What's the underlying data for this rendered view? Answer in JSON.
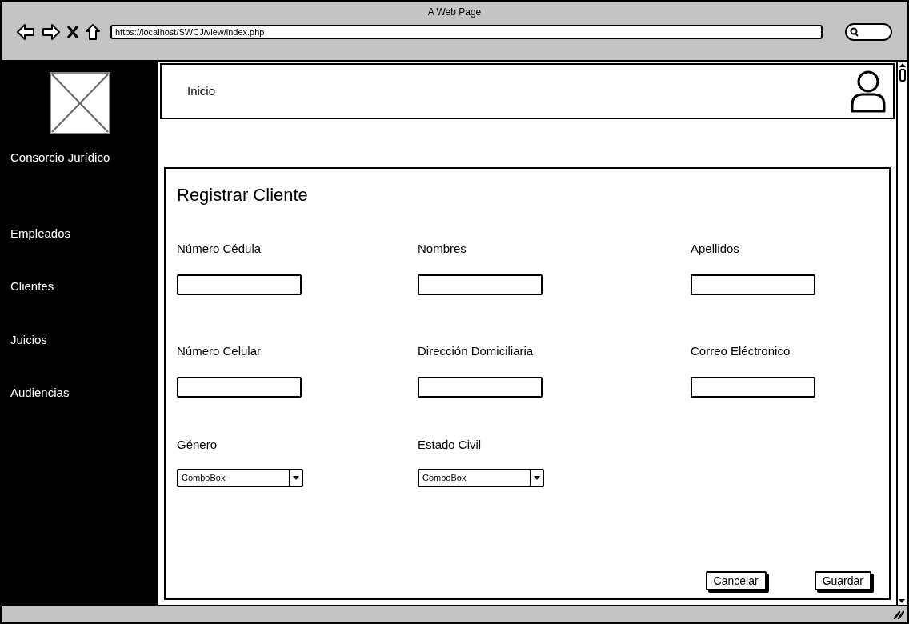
{
  "window": {
    "title": "A Web Page",
    "url": "https://localhost/SWCJ/view/index.php"
  },
  "sidebar": {
    "brand": "Consorcio Jurídico",
    "items": [
      {
        "label": "Empleados"
      },
      {
        "label": "Clientes"
      },
      {
        "label": "Juicios"
      },
      {
        "label": "Audiencias"
      }
    ]
  },
  "header": {
    "title": "Inicio"
  },
  "form": {
    "title": "Registrar Cliente",
    "fields": [
      {
        "label": "Número Cédula",
        "kind": "text"
      },
      {
        "label": "Nombres",
        "kind": "text"
      },
      {
        "label": "Apellidos",
        "kind": "text"
      },
      {
        "label": "Número Celular",
        "kind": "text"
      },
      {
        "label": "Dirección Domiciliaria",
        "kind": "text"
      },
      {
        "label": "Correo Eléctronico",
        "kind": "text"
      },
      {
        "label": "Género",
        "kind": "combo",
        "value": "ComboBox"
      },
      {
        "label": "Estado Civil",
        "kind": "combo",
        "value": "ComboBox"
      }
    ],
    "buttons": [
      "Cancelar",
      "Guardar"
    ]
  }
}
